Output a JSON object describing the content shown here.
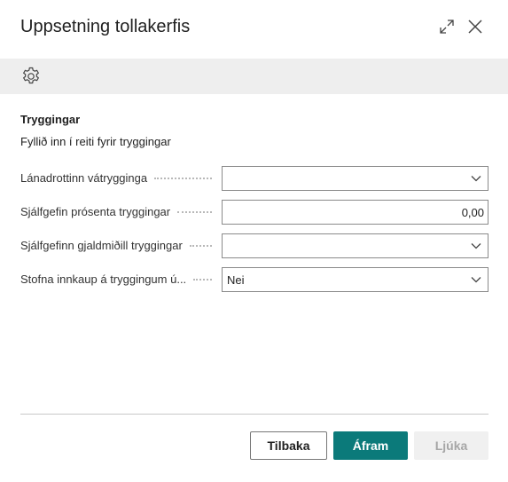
{
  "dialog": {
    "title": "Uppsetning tollakerfis",
    "expand_icon": "expand-icon",
    "close_icon": "close-icon"
  },
  "toolbar": {
    "settings_icon": "gear-icon"
  },
  "section": {
    "title": "Tryggingar",
    "description": "Fyllið inn í reiti fyrir tryggingar"
  },
  "fields": [
    {
      "label": "Lánadrottinn vátrygginga",
      "value": "",
      "type": "dropdown"
    },
    {
      "label": "Sjálfgefin prósenta tryggingar",
      "value": "0,00",
      "type": "number"
    },
    {
      "label": "Sjálfgefinn gjaldmiðill tryggingar",
      "value": "",
      "type": "dropdown"
    },
    {
      "label": "Stofna innkaup á tryggingum ú...",
      "value": "Nei",
      "type": "dropdown"
    }
  ],
  "buttons": {
    "back": "Tilbaka",
    "next": "Áfram",
    "finish": "Ljúka"
  },
  "colors": {
    "primary": "#0b7a7a",
    "toolbar_bg": "#eeeeee",
    "disabled_bg": "#f0f0f0",
    "disabled_text": "#a6a6a6"
  }
}
